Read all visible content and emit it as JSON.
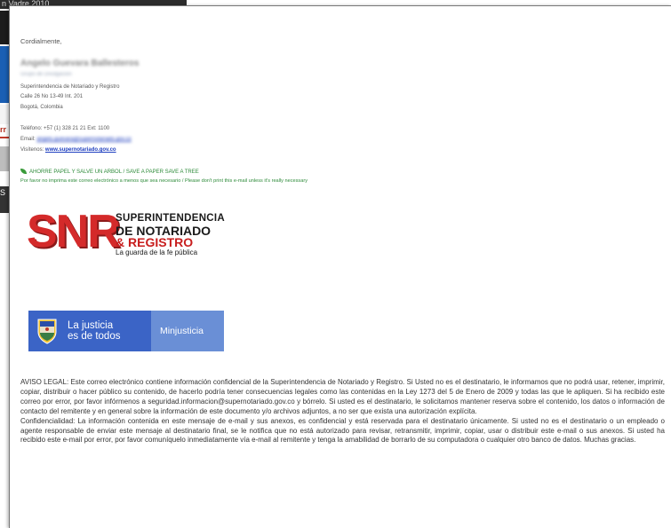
{
  "background": {
    "top_text": "n Vadre 2010",
    "side_letter": "rr",
    "side_mark": "S"
  },
  "signature": {
    "greeting": "Cordialmente,",
    "name": "Angelo Guevara Ballesteros",
    "group": "Grupo de Divulgación",
    "entity": "Superintendencia de Notariado y Registro",
    "address": "Calle 26 No 13-49 Int. 201",
    "city": "Bogotá, Colombia",
    "phone": "Teléfono: +57 (1) 328 21 21 Ext: 1100",
    "email_label": "Email:",
    "email_value": "angelo.guevara@supernotariado.gov.co",
    "visit_label": "Visítenos:",
    "visit_url": "www.supernotariado.gov.co"
  },
  "eco": {
    "line1": "AHORRE PAPEL Y SALVE UN ARBOL / SAVE A PAPER SAVE A TREE",
    "line2": "Por favor no imprima este correo electrónico a menos que sea necesario / Please don't print this e-mail unless it's really necessary"
  },
  "snr_logo": {
    "letters": "SNR",
    "line1": "SUPERINTENDENCIA",
    "line2": "DE NOTARIADO",
    "line3": "& REGISTRO",
    "tagline": "La guarda de la fe pública"
  },
  "gov_banner": {
    "line1": "La justicia",
    "line2": "es de todos",
    "ministry": "Minjusticia"
  },
  "legal": {
    "aviso": "AVISO LEGAL: Este correo electrónico contiene información confidencial de la Superintendencia de Notariado y Registro. Si Usted no es el destinatario, le informamos que no podrá usar, retener, imprimir, copiar, distribuir o hacer público su contenido, de hacerlo podría tener consecuencias legales como las contenidas en la Ley 1273 del 5 de Enero de 2009 y todas las que le apliquen. Si ha recibido este correo por error, por favor infórmenos a seguridad.informacion@supernotariado.gov.co y bórrelo. Si usted es el destinatario, le solicitamos mantener reserva sobre el contenido, los datos o información de contacto del remitente y en general sobre la información de este documento y/o archivos adjuntos, a no ser que exista una autorización explícita.",
    "confidencialidad": "Confidencialidad: La información contenida en este mensaje de e-mail y sus anexos, es confidencial y está reservada para el destinatario únicamente. Si usted no es el destinatario o un empleado o agente responsable de enviar este mensaje al destinatario final, se le notifica que no está autorizado para revisar, retransmitir, imprimir, copiar, usar o distribuir este e-mail o sus anexos. Si usted ha recibido este e-mail por error, por favor comuníquelo inmediatamente vía e-mail al remitente y tenga la amabilidad de borrarlo de su computadora o cualquier otro banco de datos. Muchas gracias."
  },
  "colors": {
    "snr_red": "#d42a2a",
    "gov_blue": "#3b64c6",
    "eco_green": "#2e8b3a",
    "link_blue": "#1f3fbf"
  }
}
